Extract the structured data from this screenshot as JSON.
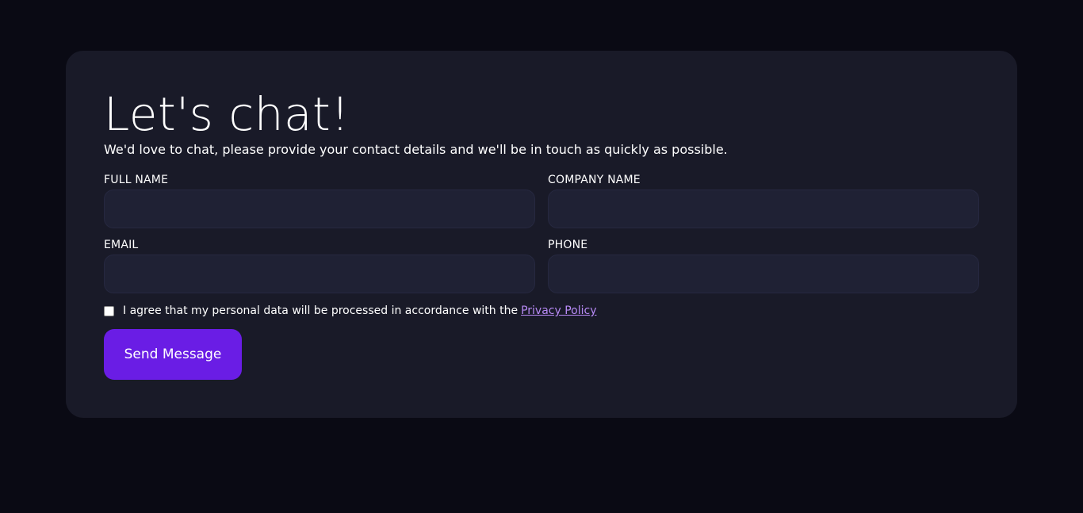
{
  "contact_card": {
    "title": "Let's chat!",
    "subtitle": "We'd love to chat, please provide your contact details and we'll be in touch as quickly as possible.",
    "fields": {
      "full_name": {
        "label": "FULL NAME",
        "value": "",
        "placeholder": ""
      },
      "company_name": {
        "label": "COMPANY NAME",
        "value": "",
        "placeholder": ""
      },
      "email": {
        "label": "EMAIL",
        "value": "",
        "placeholder": ""
      },
      "phone": {
        "label": "PHONE",
        "value": "",
        "placeholder": ""
      }
    },
    "consent": {
      "checked": false,
      "text": "I agree that my personal data will be processed in accordance with the",
      "link_label": "Privacy Policy"
    },
    "submit_label": "Send Message"
  },
  "colors": {
    "page_background": "#0a0a14",
    "card_background": "#191a28",
    "input_background": "#1f2134",
    "accent": "#6a1de5",
    "link": "#b78af5"
  }
}
